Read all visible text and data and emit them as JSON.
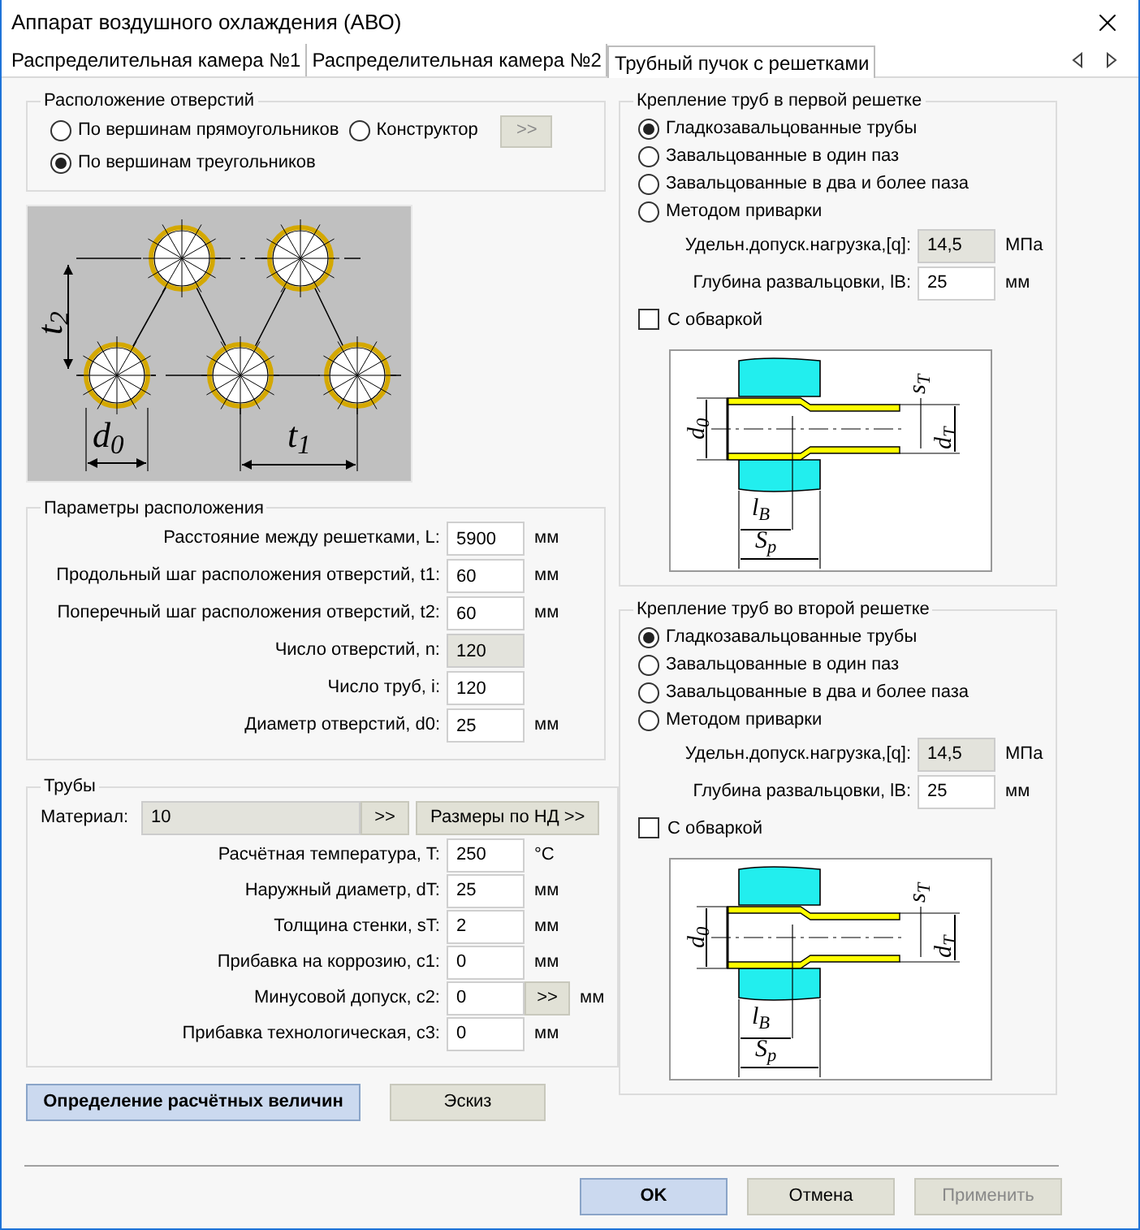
{
  "window": {
    "title": "Аппарат воздушного охлаждения (АВО)"
  },
  "tabs": [
    {
      "label": "Распределительная камера №1",
      "selected": false
    },
    {
      "label": "Распределительная камера №2",
      "selected": false
    },
    {
      "label": "Трубный пучок с решетками",
      "selected": true
    }
  ],
  "hole_layout": {
    "title": "Расположение отверстий",
    "options": [
      {
        "label": "По вершинам прямоугольников",
        "selected": false
      },
      {
        "label": "Конструктор",
        "selected": false
      },
      {
        "label": "По вершинам треугольников",
        "selected": true
      }
    ],
    "constructor_button": {
      "label": ">>",
      "disabled": true
    }
  },
  "layout_diagram": {
    "labels": [
      "t$_{2}$",
      "d$_{0}$",
      "t$_{1}$"
    ]
  },
  "layout_params": {
    "title": "Параметры расположения",
    "rows": [
      {
        "label": "Расстояние между решетками, L:",
        "value": "5900",
        "unit": "мм",
        "disabled": false
      },
      {
        "label": "Продольный шаг расположения отверстий, t1:",
        "value": "60",
        "unit": "мм",
        "disabled": false
      },
      {
        "label": "Поперечный шаг расположения отверстий, t2:",
        "value": "60",
        "unit": "мм",
        "disabled": false
      },
      {
        "label": "Число отверстий, n:",
        "value": "120",
        "disabled": true
      },
      {
        "label": "Число труб, i:",
        "value": "120",
        "disabled": false
      },
      {
        "label": "Диаметр отверстий, d0:",
        "value": "25",
        "unit": "мм",
        "disabled": false
      }
    ]
  },
  "tubes": {
    "title": "Трубы",
    "material": {
      "label": "Материал:",
      "value": "10",
      "button": ">>"
    },
    "nd_button": "Размеры по НД >>",
    "rows": [
      {
        "label": "Расчётная температура, T:",
        "value": "250",
        "unit": "°C"
      },
      {
        "label": "Наружный диаметр, dT:",
        "value": "25",
        "unit": "мм"
      },
      {
        "label": "Толщина стенки, sT:",
        "value": "2",
        "unit": "мм"
      },
      {
        "label": "Прибавка на коррозию, c1:",
        "value": "0",
        "unit": "мм"
      },
      {
        "label": "Минусовой допуск, c2:",
        "value": "0",
        "button": ">>",
        "unit": "мм"
      },
      {
        "label": "Прибавка технологическая, c3:",
        "value": "0",
        "unit": "мм"
      }
    ]
  },
  "actions": [
    {
      "label": "Определение расчётных величин",
      "default": true
    },
    {
      "label": "Эскиз",
      "default": false
    }
  ],
  "grids": [
    {
      "title": "Крепление труб в первой решетке",
      "options": [
        {
          "label": "Гладкозавальцованные трубы",
          "selected": true
        },
        {
          "label": "Завальцованные в один паз",
          "selected": false
        },
        {
          "label": "Завальцованные в два и более паза",
          "selected": false
        },
        {
          "label": "Методом приварки",
          "selected": false
        }
      ],
      "fields": [
        {
          "label": "Удельн.допуск.нагрузка,[q]:",
          "value": "14,5",
          "unit": "МПа",
          "disabled": true
        },
        {
          "label": "Глубина развальцовки, lB:",
          "value": "25",
          "unit": "мм",
          "disabled": false
        }
      ],
      "weld": {
        "label": "С обваркой",
        "checked": false
      },
      "diagram_labels": [
        "d$_{0}$",
        "s$_{T}$",
        "d$_{T}$",
        "l$_{B}$",
        "S$_{p}$"
      ]
    },
    {
      "title": "Крепление труб во второй решетке",
      "options": [
        {
          "label": "Гладкозавальцованные трубы",
          "selected": true
        },
        {
          "label": "Завальцованные в один паз",
          "selected": false
        },
        {
          "label": "Завальцованные в два и более паза",
          "selected": false
        },
        {
          "label": "Методом приварки",
          "selected": false
        }
      ],
      "fields": [
        {
          "label": "Удельн.допуск.нагрузка,[q]:",
          "value": "14,5",
          "unit": "МПа",
          "disabled": true
        },
        {
          "label": "Глубина развальцовки, lB:",
          "value": "25",
          "unit": "мм",
          "disabled": false
        }
      ],
      "weld": {
        "label": "С обваркой",
        "checked": false
      },
      "diagram_labels": [
        "d$_{0}$",
        "s$_{T}$",
        "d$_{T}$",
        "l$_{B}$",
        "S$_{p}$"
      ]
    }
  ],
  "footer": [
    {
      "label": "OK",
      "kind": "default",
      "disabled": false
    },
    {
      "label": "Отмена",
      "kind": "normal",
      "disabled": false
    },
    {
      "label": "Применить",
      "kind": "normal",
      "disabled": true
    }
  ]
}
